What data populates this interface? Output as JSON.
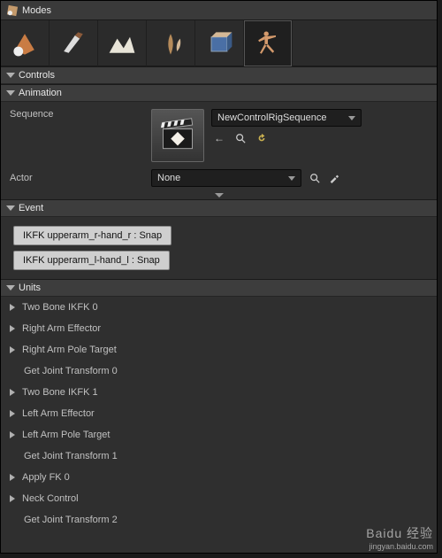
{
  "window": {
    "title": "Modes"
  },
  "toolbar": {
    "items": [
      "place",
      "paint",
      "landscape",
      "foliage",
      "brush",
      "run"
    ],
    "active_index": 5
  },
  "sections": {
    "controls": "Controls",
    "animation": "Animation",
    "event": "Event",
    "units": "Units"
  },
  "animation": {
    "sequence_label": "Sequence",
    "sequence_value": "NewControlRigSequence",
    "nav_back": "←",
    "nav_search": "search-icon",
    "nav_reset": "↺",
    "actor_label": "Actor",
    "actor_value": "None",
    "actor_search": "search-icon",
    "actor_pick": "picker-icon"
  },
  "event": {
    "buttons": [
      "IKFK upperarm_r-hand_r : Snap",
      "IKFK upperarm_l-hand_l : Snap"
    ]
  },
  "units": {
    "items": [
      {
        "label": "Two Bone IKFK 0",
        "type": "branch"
      },
      {
        "label": "Right Arm Effector",
        "type": "branch"
      },
      {
        "label": "Right Arm Pole Target",
        "type": "branch"
      },
      {
        "label": "Get Joint Transform 0",
        "type": "child"
      },
      {
        "label": "Two Bone IKFK 1",
        "type": "branch"
      },
      {
        "label": "Left Arm Effector",
        "type": "branch"
      },
      {
        "label": "Left Arm Pole Target",
        "type": "branch"
      },
      {
        "label": "Get Joint Transform 1",
        "type": "child"
      },
      {
        "label": "Apply FK 0",
        "type": "branch"
      },
      {
        "label": "Neck Control",
        "type": "branch"
      },
      {
        "label": "Get Joint Transform 2",
        "type": "child"
      }
    ]
  },
  "watermark": {
    "line1": "Baidu 经验",
    "line2": "jingyan.baidu.com"
  }
}
